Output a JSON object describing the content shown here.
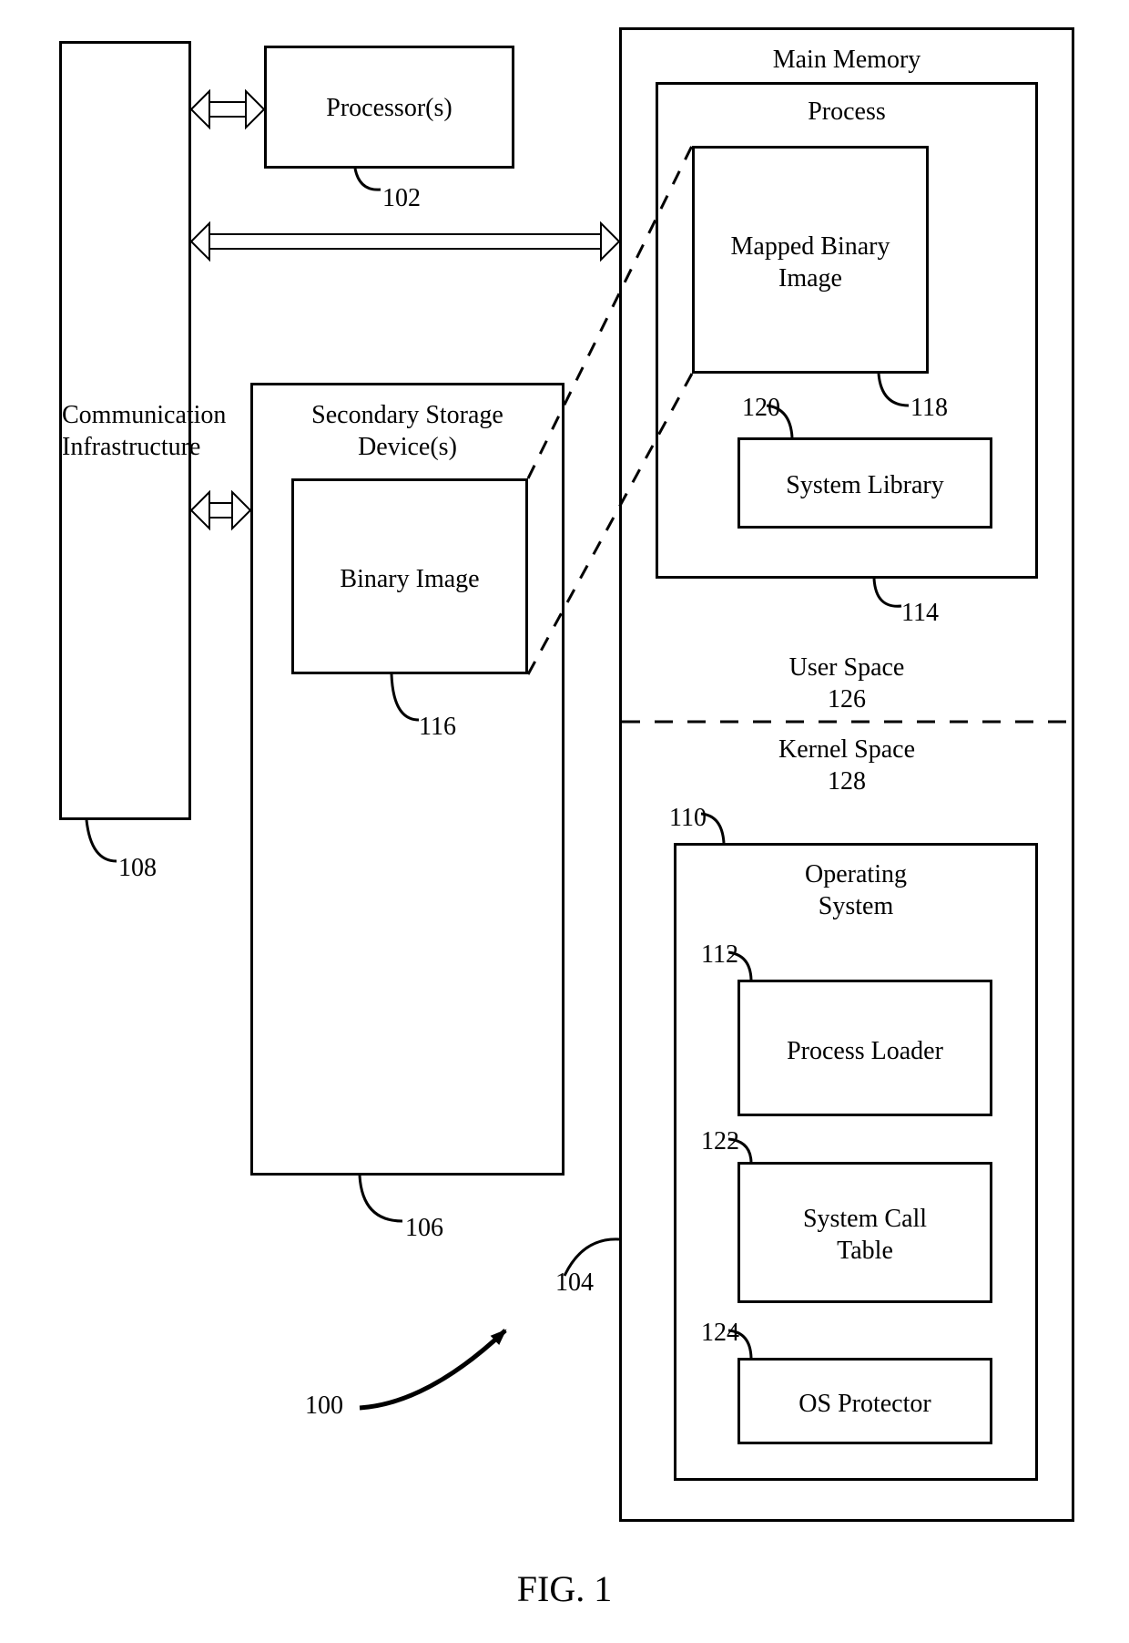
{
  "figure": "FIG. 1",
  "ref_overall": "100",
  "comm": {
    "label": "Communication\nInfrastructure",
    "ref": "108"
  },
  "processor": {
    "label": "Processor(s)",
    "ref": "102"
  },
  "secondary": {
    "label": "Secondary Storage\nDevice(s)",
    "ref": "106"
  },
  "binary": {
    "label": "Binary Image",
    "ref": "116"
  },
  "main_memory": {
    "label": "Main Memory",
    "ref": "104"
  },
  "process": {
    "label": "Process",
    "ref": "114"
  },
  "mapped": {
    "label": "Mapped Binary\nImage",
    "ref": "118"
  },
  "syslib": {
    "label": "System Library",
    "ref": "120"
  },
  "user_space": {
    "label": "User Space",
    "ref": "126"
  },
  "kernel_space": {
    "label": "Kernel Space",
    "ref": "128"
  },
  "os": {
    "label": "Operating\nSystem",
    "ref": "110"
  },
  "loader": {
    "label": "Process Loader",
    "ref": "112"
  },
  "syscall": {
    "label": "System Call\nTable",
    "ref": "122"
  },
  "protector": {
    "label": "OS Protector",
    "ref": "124"
  }
}
